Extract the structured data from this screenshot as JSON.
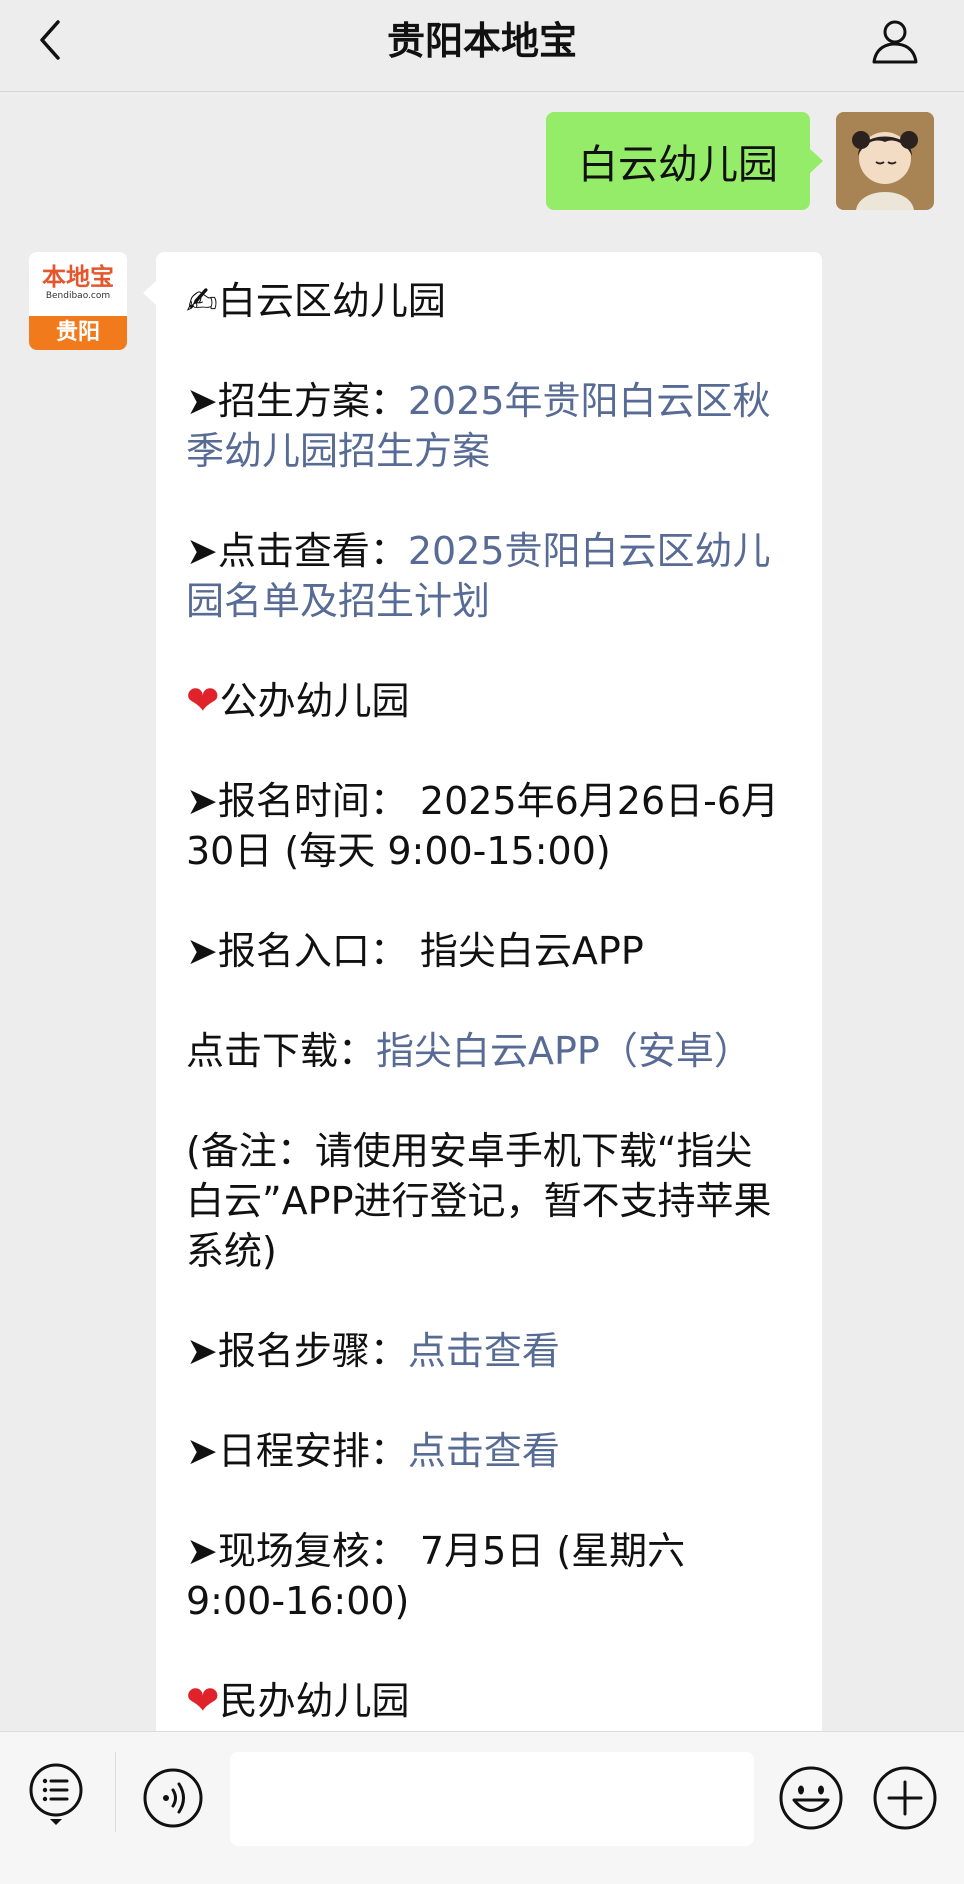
{
  "header": {
    "title": "贵阳本地宝"
  },
  "outgoing": {
    "text": "白云幼儿园"
  },
  "sender_avatar": {
    "brand": "本地宝",
    "domain": "Bendibao.com",
    "city": "贵阳"
  },
  "message": {
    "heading": "✍白云区幼儿园",
    "plan": {
      "label": "➤招生方案：",
      "link": "2025年贵阳白云区秋季幼儿园招生方案"
    },
    "view": {
      "label": "➤点击查看：",
      "link": "2025贵阳白云区幼儿园名单及招生计划"
    },
    "public_heading": "公办幼儿园",
    "reg_time": "➤报名时间： 2025年6月26日-6月30日 (每天 9:00-15:00)",
    "reg_entry": "➤报名入口： 指尖白云APP",
    "download": {
      "label": "点击下载：",
      "link": "指尖白云APP（安卓）"
    },
    "note": "(备注：请使用安卓手机下载“指尖白云”APP进行登记，暂不支持苹果系统)",
    "steps": {
      "label": "➤报名步骤：",
      "link": "点击查看"
    },
    "schedule": {
      "label": "➤日程安排：",
      "link": "点击查看"
    },
    "review": "➤现场复核： 7月5日 (星期六 9:00-16:00)",
    "private_heading": "民办幼儿园"
  },
  "icons": {
    "back": "chevron-left-icon",
    "profile": "person-icon",
    "menu": "list-menu-icon",
    "voice": "voice-icon",
    "emoji": "smiley-icon",
    "add": "plus-icon"
  },
  "colors": {
    "outgoing_bubble": "#95ec69",
    "link": "#576b95",
    "heart": "#e0222a",
    "brand_orange": "#f17b1c"
  }
}
